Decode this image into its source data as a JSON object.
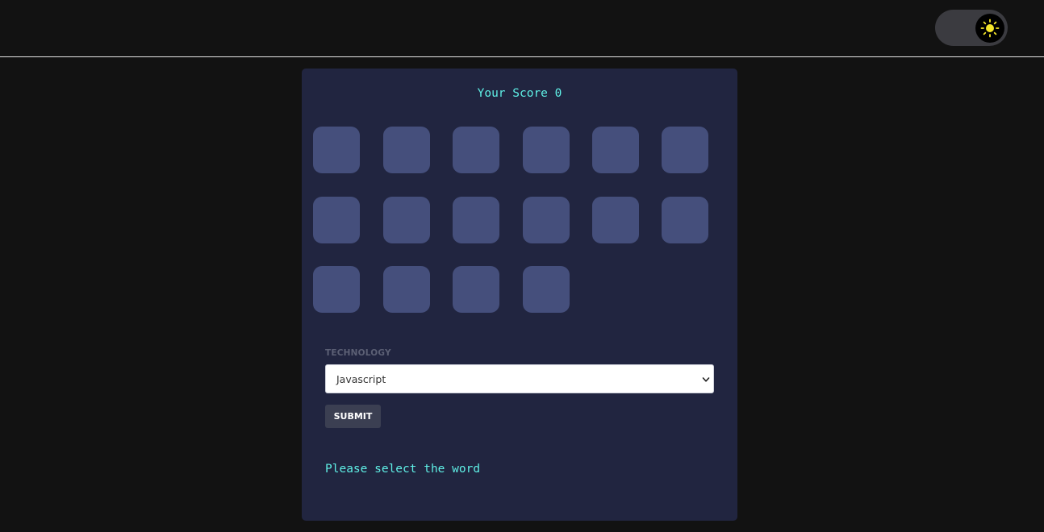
{
  "header": {
    "theme_toggle": {
      "icon": "sun-icon",
      "mode": "dark",
      "icon_color": "#f5e52a"
    }
  },
  "game": {
    "score_text": "Your Score 0",
    "tiles": [
      "",
      "",
      "",
      "",
      "",
      "",
      "",
      "",
      "",
      "",
      "",
      "",
      "",
      "",
      "",
      ""
    ],
    "tile_color": "#454f7c"
  },
  "form": {
    "label": "TECHNOLOGY",
    "select_value": "Javascript",
    "submit_label": "SUBMIT"
  },
  "status_message": "Please select the word",
  "colors": {
    "background": "#121212",
    "card": "#212540",
    "accent_text": "#5ff0e6"
  }
}
